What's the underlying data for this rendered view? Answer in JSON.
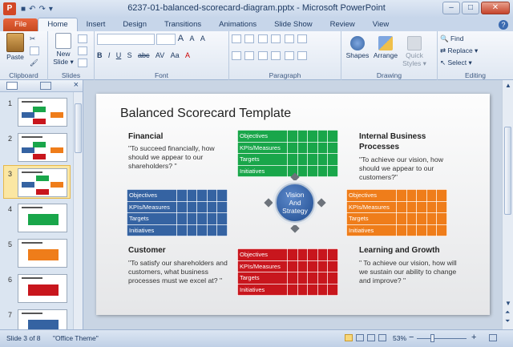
{
  "window": {
    "app_icon": "P",
    "title": "6237-01-balanced-scorecard-diagram.pptx  -  Microsoft PowerPoint",
    "controls": {
      "minimize": "–",
      "maximize": "□",
      "close": "✕"
    },
    "help": "?"
  },
  "tabs": [
    "File",
    "Home",
    "Insert",
    "Design",
    "Transitions",
    "Animations",
    "Slide Show",
    "Review",
    "View"
  ],
  "ribbon": {
    "clipboard": {
      "label": "Clipboard",
      "paste": "Paste"
    },
    "slides": {
      "label": "Slides",
      "new_slide_line1": "New",
      "new_slide_line2": "Slide ▾"
    },
    "font": {
      "label": "Font",
      "grow": "A",
      "shrink": "A",
      "clear": "A",
      "bold": "B",
      "italic": "I",
      "underline": "U",
      "shadow": "S",
      "strike": "abc",
      "spacing": "AV",
      "case": "Aa",
      "color": "A"
    },
    "paragraph": {
      "label": "Paragraph"
    },
    "drawing": {
      "label": "Drawing",
      "shapes": "Shapes",
      "arrange": "Arrange",
      "quick_line1": "Quick",
      "quick_line2": "Styles ▾"
    },
    "editing": {
      "label": "Editing",
      "find": "Find",
      "replace": "Replace ▾",
      "select": "Select ▾"
    }
  },
  "thumbnails": [
    {
      "num": "1"
    },
    {
      "num": "2"
    },
    {
      "num": "3"
    },
    {
      "num": "4"
    },
    {
      "num": "5"
    },
    {
      "num": "6"
    },
    {
      "num": "7"
    }
  ],
  "slide": {
    "title": "Balanced Scorecard Template",
    "financial": {
      "heading": "Financial",
      "text": "\"To succeed financially, how should we appear to our shareholders? \""
    },
    "internal": {
      "heading": "Internal Business Processes",
      "text": "\"To achieve our vision, how should we appear to our customers?\""
    },
    "customer": {
      "heading": "Customer",
      "text": "\"To satisfy our shareholders and customers, what business processes must we excel at? \""
    },
    "learning": {
      "heading": "Learning and Growth",
      "text": "\" To achieve our vision, how will we sustain our ability to change and improve? \""
    },
    "rows": [
      "Objectives",
      "KPIs/Measures",
      "Targets",
      "Initiatives"
    ],
    "center_line1": "Vision",
    "center_line2": "And",
    "center_line3": "Strategy",
    "colors": {
      "green": "#19a64a",
      "blue": "#3563a2",
      "orange": "#ef7d1a",
      "red": "#c8161d",
      "center": "#2c5aa0"
    }
  },
  "status": {
    "slide_info": "Slide 3 of 8",
    "theme": "\"Office Theme\"",
    "zoom": "53%",
    "zoom_out": "−",
    "zoom_in": "+"
  }
}
